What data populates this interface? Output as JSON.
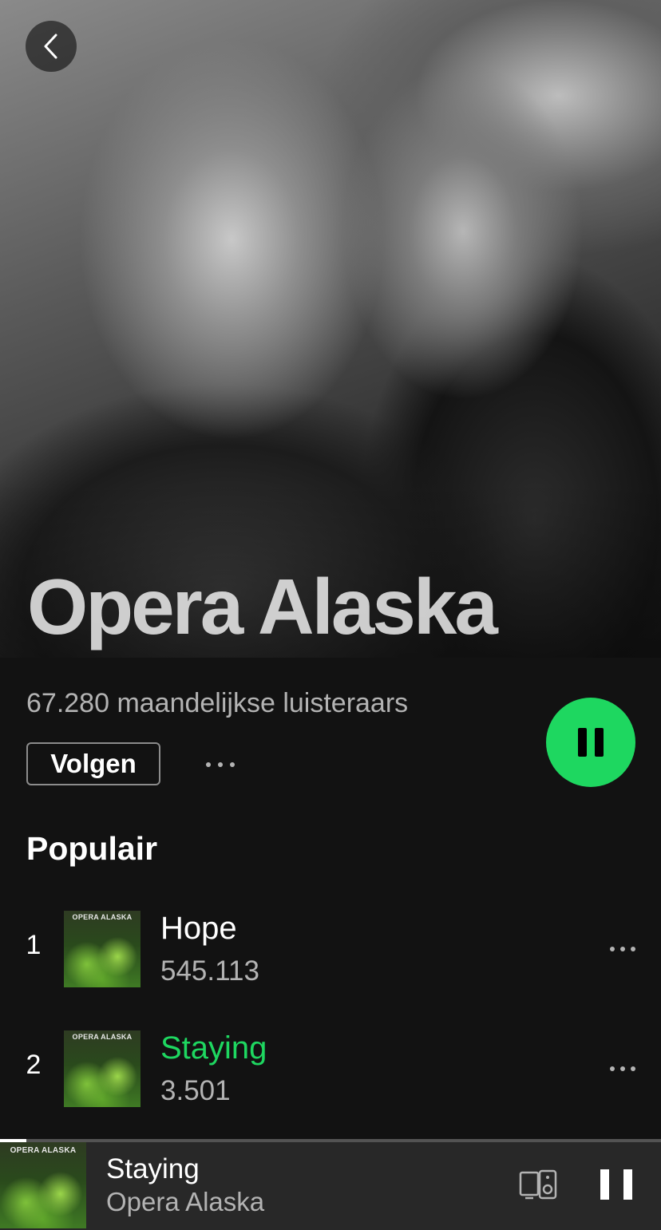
{
  "artist": {
    "name": "Opera Alaska",
    "monthly_listeners": "67.280 maandelijkse luisteraars"
  },
  "actions": {
    "follow_label": "Volgen",
    "more_icon": "ellipsis-icon",
    "play_state_icon": "pause-icon",
    "back_icon": "chevron-left-icon"
  },
  "popular": {
    "title": "Populair",
    "tracks": [
      {
        "number": "1",
        "title": "Hope",
        "plays": "545.113",
        "cover_text": "OPERA ALASKA",
        "playing": false
      },
      {
        "number": "2",
        "title": "Staying",
        "plays": "3.501",
        "cover_text": "OPERA ALASKA",
        "playing": true
      }
    ]
  },
  "now_playing": {
    "title": "Staying",
    "artist": "Opera Alaska",
    "cover_text": "OPERA ALASKA",
    "progress": 0.04,
    "device_icon": "devices-icon",
    "control_icon": "pause-icon"
  },
  "colors": {
    "accent": "#1ed760",
    "background": "#121212",
    "player_bar": "#282828",
    "secondary_text": "#b3b3b3"
  }
}
